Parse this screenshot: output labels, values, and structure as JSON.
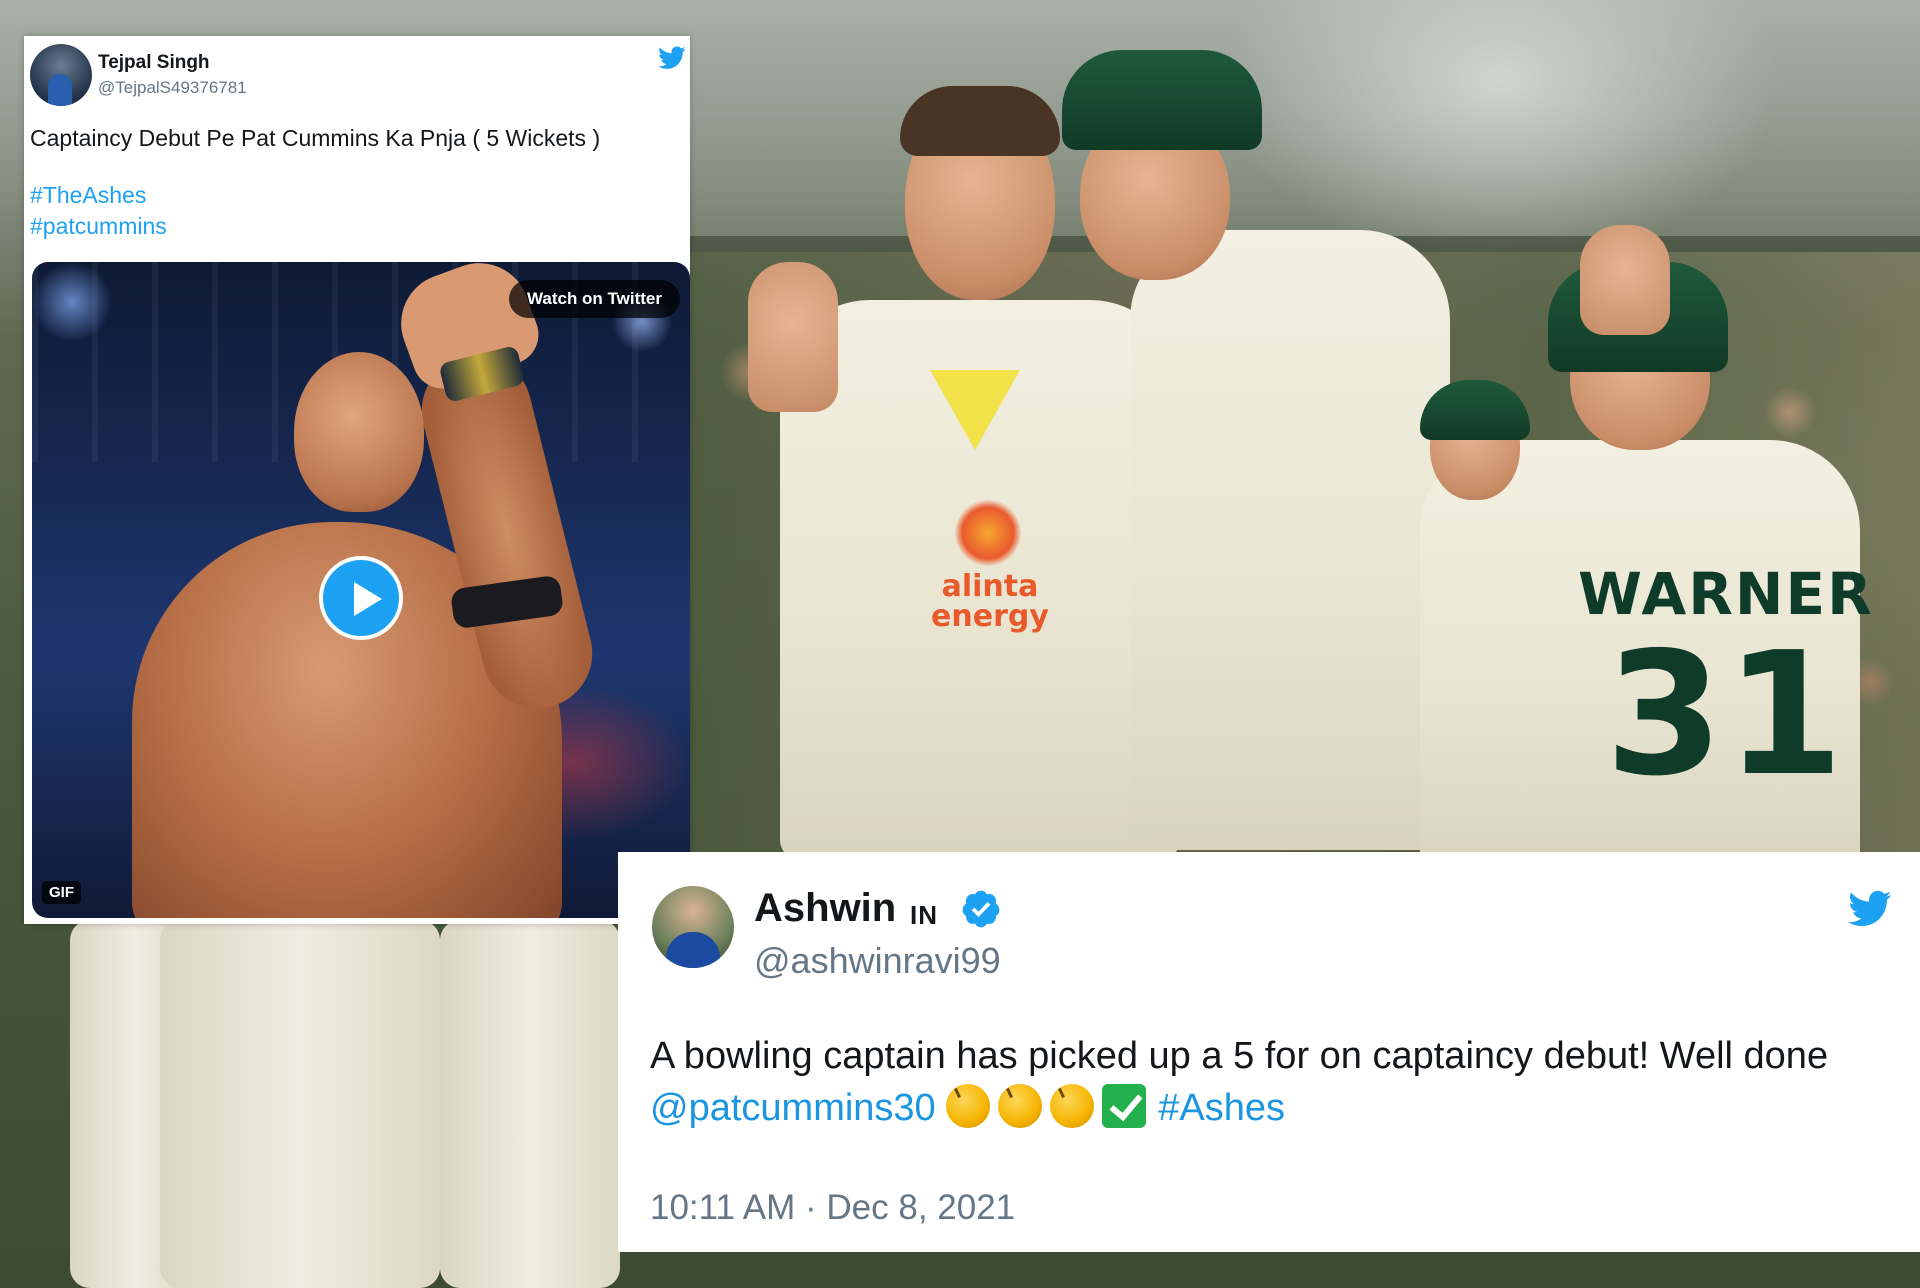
{
  "background": {
    "jersey_name": "WARNER",
    "jersey_number": "31",
    "sponsor": "alinta energy"
  },
  "tweet_tejpal": {
    "name": "Tejpal Singh",
    "handle": "@TejpalS49376781",
    "text": "Captaincy Debut Pe Pat Cummins Ka Pnja ( 5 Wickets )",
    "hashtags": [
      "#TheAshes",
      "#patcummins"
    ],
    "media": {
      "watch_label": "Watch on Twitter",
      "gif_badge": "GIF"
    },
    "icon": "twitter-bird-icon"
  },
  "tweet_ashwin": {
    "name": "Ashwin",
    "flag": "IN",
    "handle": "@ashwinravi99",
    "text_part1": "A bowling captain has picked up a 5 for on captaincy debut! Well done ",
    "mention": "@patcummins30",
    "hashtag": "#Ashes",
    "emoji": [
      "clapping-hands",
      "clapping-hands",
      "clapping-hands",
      "check-mark"
    ],
    "time": "10:11 AM",
    "separator": "·",
    "date": "Dec 8, 2021",
    "icon": "twitter-bird-icon"
  },
  "colors": {
    "twitter_blue": "#1da1f2",
    "text_dark": "#14171a",
    "text_grey": "#657786",
    "jersey_green": "#0f3b2a"
  }
}
